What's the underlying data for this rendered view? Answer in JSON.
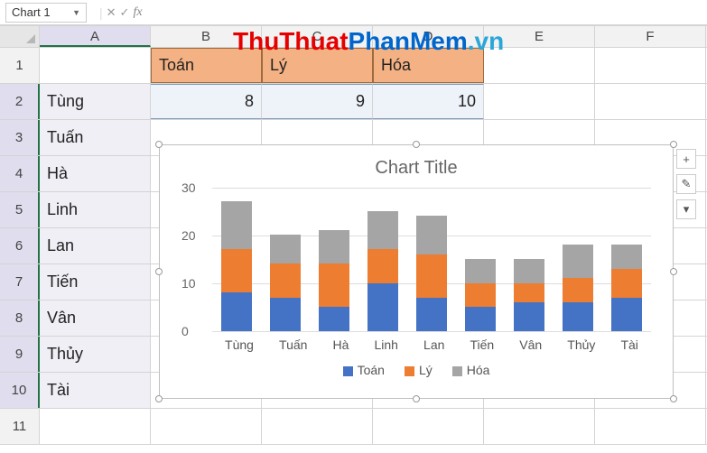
{
  "name_box": "Chart 1",
  "watermark": {
    "part1": "ThuThuat",
    "part2": "PhanMem",
    "part3": ".vn"
  },
  "columns": [
    "A",
    "B",
    "C",
    "D",
    "E",
    "F"
  ],
  "row_numbers": [
    "1",
    "2",
    "3",
    "4",
    "5",
    "6",
    "7",
    "8",
    "9",
    "10",
    "11"
  ],
  "sheet": {
    "headers": [
      "Toán",
      "Lý",
      "Hóa"
    ],
    "first_row_values": [
      "8",
      "9",
      "10"
    ],
    "names": [
      "Tùng",
      "Tuấn",
      "Hà",
      "Linh",
      "Lan",
      "Tiến",
      "Vân",
      "Thủy",
      "Tài"
    ]
  },
  "chart_data": {
    "type": "bar",
    "stacked": true,
    "title": "Chart Title",
    "categories": [
      "Tùng",
      "Tuấn",
      "Hà",
      "Linh",
      "Lan",
      "Tiến",
      "Vân",
      "Thủy",
      "Tài"
    ],
    "series": [
      {
        "name": "Toán",
        "values": [
          8,
          7,
          5,
          10,
          7,
          5,
          6,
          6,
          7
        ],
        "color": "#4472c4"
      },
      {
        "name": "Lý",
        "values": [
          9,
          7,
          9,
          7,
          9,
          5,
          4,
          5,
          6
        ],
        "color": "#ed7d31"
      },
      {
        "name": "Hóa",
        "values": [
          10,
          6,
          7,
          8,
          8,
          5,
          5,
          7,
          5
        ],
        "color": "#a5a5a5"
      }
    ],
    "ylabel": "",
    "xlabel": "",
    "ylim": [
      0,
      30
    ],
    "yticks": [
      0,
      10,
      20,
      30
    ]
  },
  "side_buttons": [
    "+",
    "✎",
    "▾"
  ]
}
